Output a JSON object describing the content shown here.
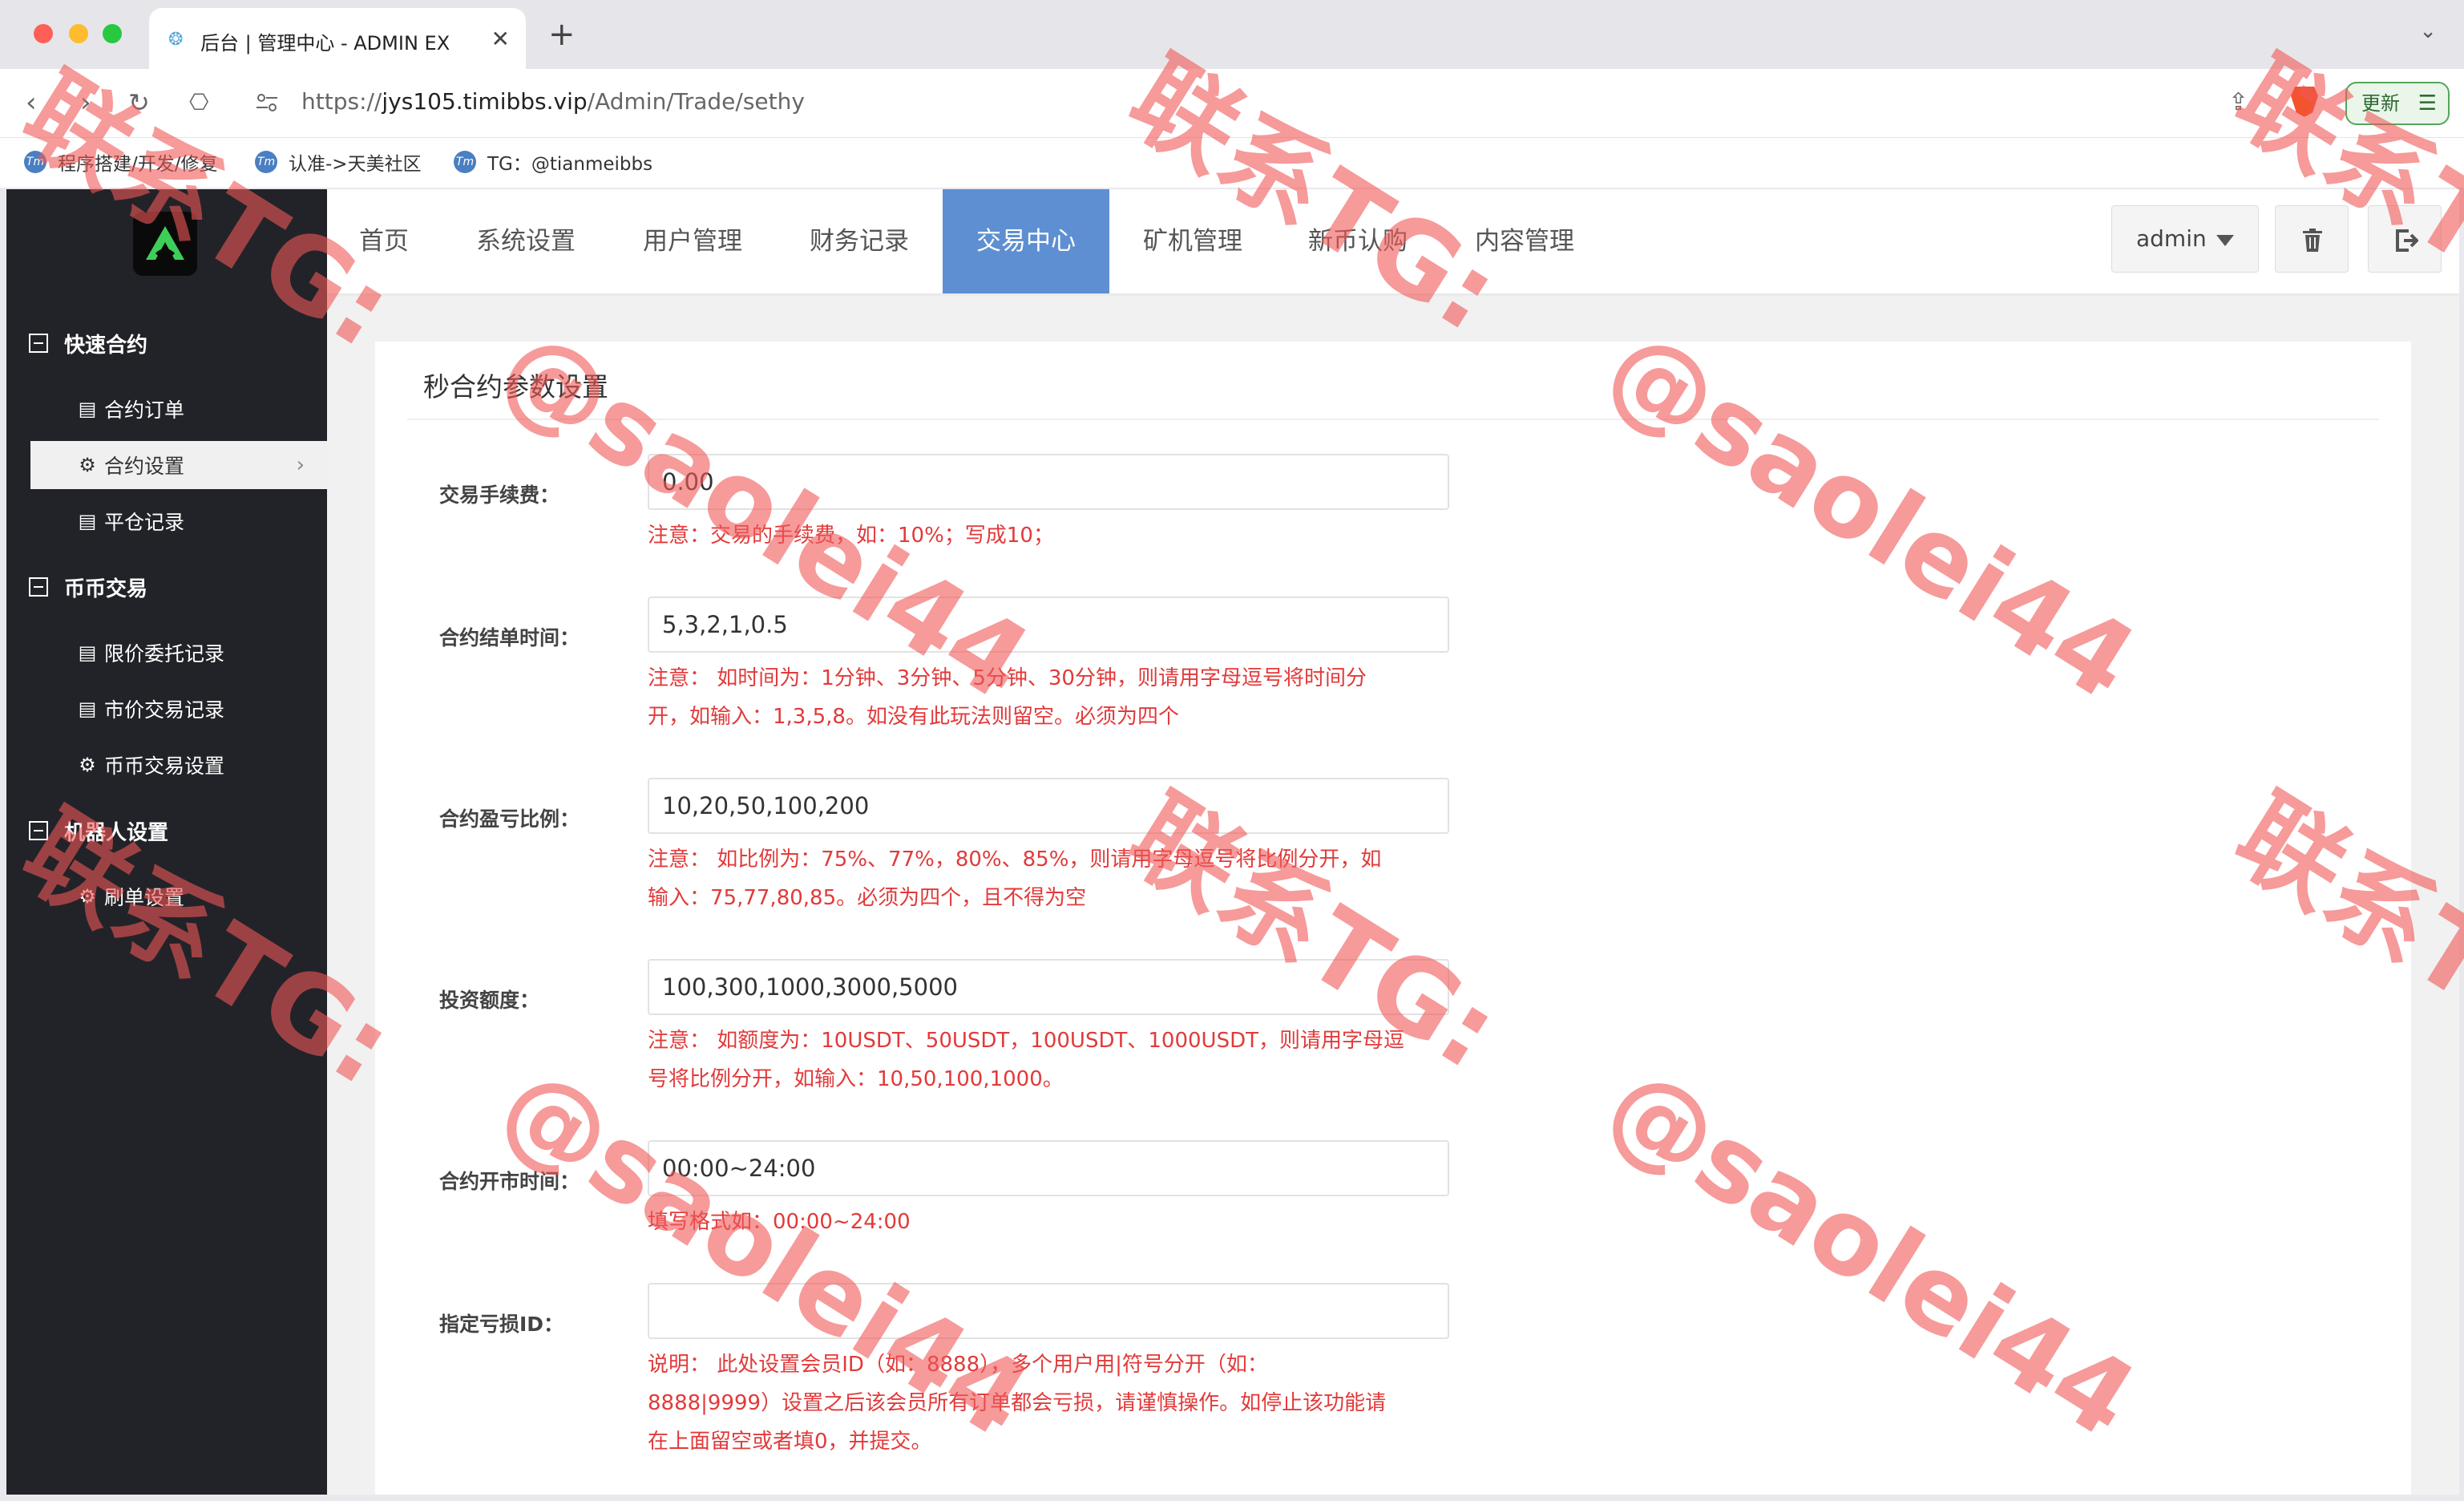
{
  "browser": {
    "tab_title": "后台 | 管理中心 - ADMIN EX",
    "url_scheme": "https://",
    "url_host": "jys105.timibbs.vip",
    "url_path": "/Admin/Trade/sethy",
    "update_label": "更新",
    "bookmarks": [
      "程序搭建/开发/修复",
      "认准->天美社区",
      "TG：@tianmeibbs"
    ]
  },
  "sidebar": {
    "groups": [
      {
        "label": "快速合约",
        "items": [
          {
            "label": "合约订单",
            "icon": "list-icon"
          },
          {
            "label": "合约设置",
            "icon": "gear-icon",
            "active": true
          },
          {
            "label": "平仓记录",
            "icon": "list-icon"
          }
        ]
      },
      {
        "label": "币币交易",
        "items": [
          {
            "label": "限价委托记录",
            "icon": "list-icon"
          },
          {
            "label": "市价交易记录",
            "icon": "list-icon"
          },
          {
            "label": "币币交易设置",
            "icon": "gear-icon"
          }
        ]
      },
      {
        "label": "机器人设置",
        "items": [
          {
            "label": "刷单设置",
            "icon": "gear-icon"
          }
        ]
      }
    ]
  },
  "topnav": {
    "items": [
      "首页",
      "系统设置",
      "用户管理",
      "财务记录",
      "交易中心",
      "矿机管理",
      "新币认购",
      "内容管理"
    ],
    "active_index": 4,
    "user": "admin",
    "accent_color": "#5e8fd2"
  },
  "panel": {
    "title": "秒合约参数设置",
    "fields": [
      {
        "label": "交易手续费：",
        "value": "0.00",
        "notes": [
          "注意：交易的手续费，如：10%；写成10；"
        ]
      },
      {
        "label": "合约结单时间：",
        "value": "5,3,2,1,0.5",
        "notes": [
          "注意：  如时间为：1分钟、3分钟、5分钟、30分钟，则请用字母逗号将时间分",
          "开，如输入：1,3,5,8。如没有此玩法则留空。必须为四个"
        ]
      },
      {
        "label": "合约盈亏比例：",
        "value": "10,20,50,100,200",
        "notes": [
          "注意：  如比例为：75%、77%，80%、85%，则请用字母逗号将比例分开，如",
          "输入：75,77,80,85。必须为四个，且不得为空"
        ]
      },
      {
        "label": "投资额度：",
        "value": "100,300,1000,3000,5000",
        "notes": [
          "注意：  如额度为：10USDT、50USDT，100USDT、1000USDT，则请用字母逗",
          "号将比例分开，如输入：10,50,100,1000。"
        ]
      },
      {
        "label": "合约开市时间：",
        "value": "00:00~24:00",
        "notes": [
          "填写格式如：00:00~24:00"
        ]
      },
      {
        "label": "指定亏损ID：",
        "value": "",
        "notes": [
          "说明：  此处设置会员ID（如：8888），多个用户用|符号分开（如：",
          "8888|9999）设置之后该会员所有订单都会亏损，请谨慎操作。如停止该功能请",
          "在上面留空或者填0，并提交。"
        ]
      }
    ],
    "note_color": "#e23a3a"
  },
  "watermark": {
    "contact": "联系TG:",
    "handle": "@saolei44",
    "color": "#f05656"
  }
}
